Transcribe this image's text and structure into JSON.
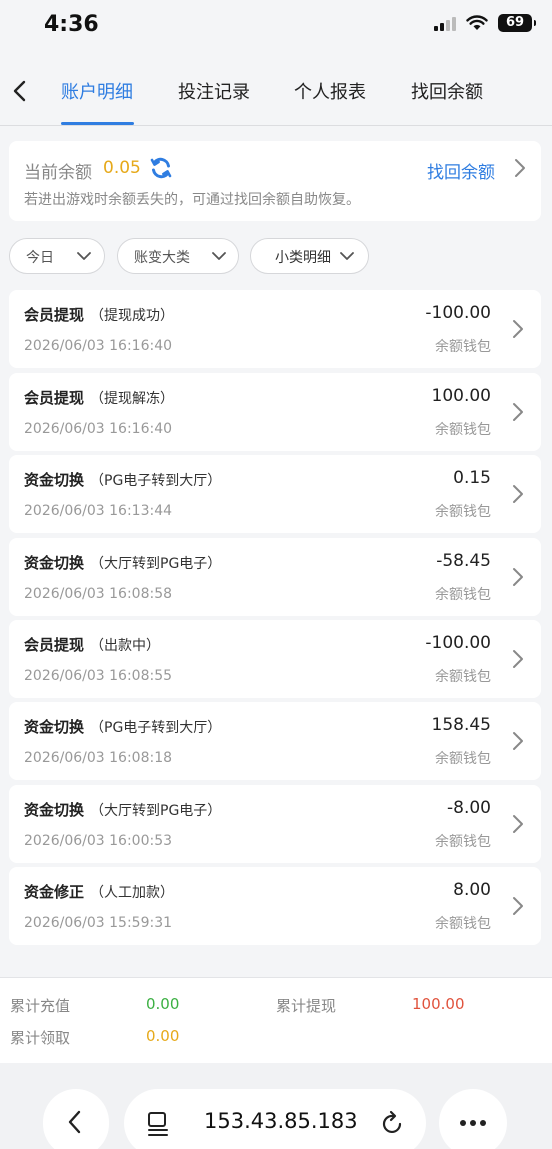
{
  "status": {
    "time": "4:36",
    "battery": "69"
  },
  "nav": {
    "tabs": [
      {
        "label": "账户明细",
        "active": true
      },
      {
        "label": "投注记录",
        "active": false
      },
      {
        "label": "个人报表",
        "active": false
      },
      {
        "label": "找回余额",
        "active": false
      }
    ]
  },
  "balance": {
    "label": "当前余额",
    "value": "0.05",
    "recover_label": "找回余额",
    "hint": "若进出游戏时余额丢失的，可通过找回余额自助恢复。"
  },
  "filters": [
    {
      "label": "今日"
    },
    {
      "label": "账变大类"
    },
    {
      "label": "小类明细"
    }
  ],
  "records": [
    {
      "title": "会员提现",
      "sub": "（提现成功）",
      "time": "2026/06/03 16:16:40",
      "amount": "-100.00",
      "wallet": "余额钱包"
    },
    {
      "title": "会员提现",
      "sub": "（提现解冻）",
      "time": "2026/06/03 16:16:40",
      "amount": "100.00",
      "wallet": "余额钱包"
    },
    {
      "title": "资金切换",
      "sub": "（PG电子转到大厅）",
      "time": "2026/06/03 16:13:44",
      "amount": "0.15",
      "wallet": "余额钱包"
    },
    {
      "title": "资金切换",
      "sub": "（大厅转到PG电子）",
      "time": "2026/06/03 16:08:58",
      "amount": "-58.45",
      "wallet": "余额钱包"
    },
    {
      "title": "会员提现",
      "sub": "（出款中）",
      "time": "2026/06/03 16:08:55",
      "amount": "-100.00",
      "wallet": "余额钱包"
    },
    {
      "title": "资金切换",
      "sub": "（PG电子转到大厅）",
      "time": "2026/06/03 16:08:18",
      "amount": "158.45",
      "wallet": "余额钱包"
    },
    {
      "title": "资金切换",
      "sub": "（大厅转到PG电子）",
      "time": "2026/06/03 16:00:53",
      "amount": "-8.00",
      "wallet": "余额钱包"
    },
    {
      "title": "资金修正",
      "sub": "（人工加款）",
      "time": "2026/06/03 15:59:31",
      "amount": "8.00",
      "wallet": "余额钱包"
    }
  ],
  "summary": {
    "recharge_label": "累计充值",
    "recharge_value": "0.00",
    "withdraw_label": "累计提现",
    "withdraw_value": "100.00",
    "claim_label": "累计领取",
    "claim_value": "0.00"
  },
  "browser": {
    "url": "153.43.85.183"
  },
  "colors": {
    "accent": "#2f7de1",
    "balance": "#e6a91a",
    "recharge": "#3cb043",
    "withdraw": "#e0533d",
    "claim": "#e6a91a"
  }
}
